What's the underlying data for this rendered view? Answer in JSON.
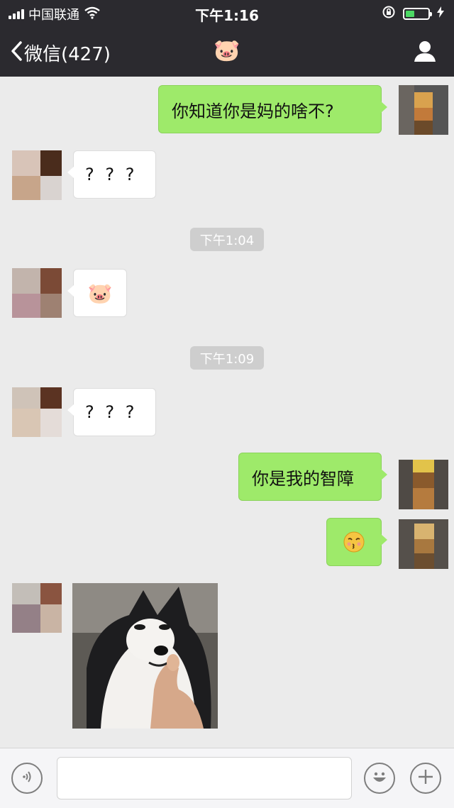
{
  "status_bar": {
    "carrier": "中国联通",
    "time": "下午1:16"
  },
  "nav": {
    "back_label": "微信(427)",
    "title_emoji": "🐷"
  },
  "messages": [
    {
      "side": "me",
      "text": "你知道你是妈的啥不?"
    },
    {
      "side": "other",
      "text": "? ? ?"
    },
    {
      "timestamp": "下午1:04"
    },
    {
      "side": "other",
      "text": "🐷"
    },
    {
      "timestamp": "下午1:09"
    },
    {
      "side": "other",
      "text": "? ? ?"
    },
    {
      "side": "me",
      "text": "你是我的智障"
    },
    {
      "side": "me",
      "text": "😚"
    },
    {
      "side": "other",
      "image": "husky-thumbs-up"
    }
  ],
  "input": {
    "placeholder": ""
  },
  "colors": {
    "me_bubble": "#9eea6a",
    "other_bubble": "#ffffff",
    "header": "#2b2a2f",
    "background": "#ebebeb"
  }
}
